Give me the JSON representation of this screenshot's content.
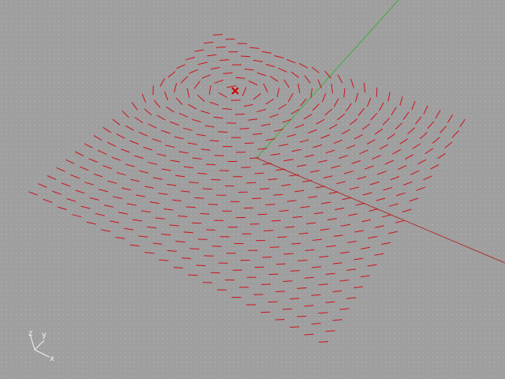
{
  "viewport": {
    "background": "#9f9f9f",
    "grid_dot_color": "#b8b8b8"
  },
  "world_axes": {
    "x_axis_color": "#b03030",
    "y_axis_color": "#3fae3f"
  },
  "vector_field": {
    "color": "#d0101a",
    "rows": 21,
    "cols": 21,
    "style": "tangent-dashes-around-center"
  },
  "attractor_point": {
    "icon": "x-marker-icon",
    "color": "#d00000"
  },
  "axis_gizmo": {
    "color": "#f2f2f2",
    "labels": {
      "z": "z",
      "y": "y",
      "x": "x"
    }
  }
}
